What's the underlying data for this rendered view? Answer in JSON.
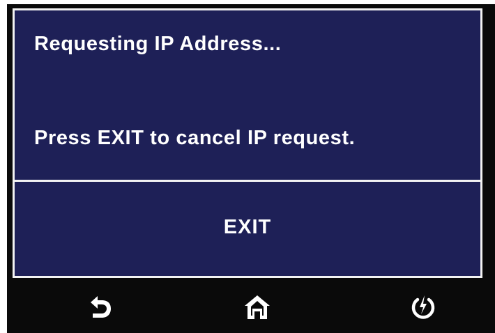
{
  "dialog": {
    "status_text": "Requesting IP Address...",
    "instruction_text": "Press EXIT to cancel IP request.",
    "exit_label": "EXIT"
  },
  "navbar": {
    "items": [
      {
        "icon": "back-arrow-icon"
      },
      {
        "icon": "home-icon"
      },
      {
        "icon": "power-icon"
      }
    ]
  },
  "colors": {
    "panel_background": "#1e2057",
    "border": "#f2f2f2",
    "bezel": "#0a0a0a",
    "text": "#ffffff"
  }
}
